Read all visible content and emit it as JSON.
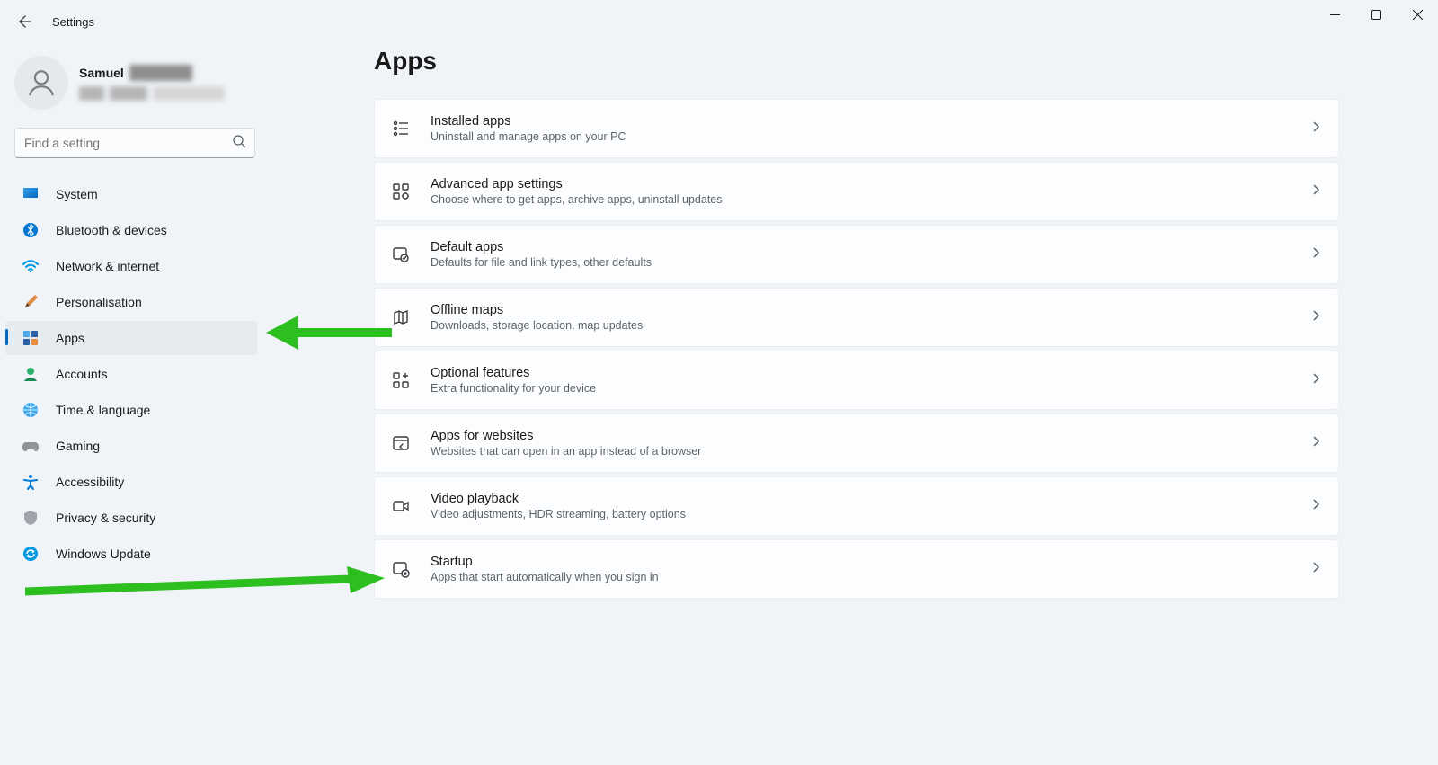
{
  "window": {
    "title": "Settings"
  },
  "profile": {
    "first_name": "Samuel"
  },
  "search": {
    "placeholder": "Find a setting"
  },
  "nav": {
    "items": [
      {
        "label": "System"
      },
      {
        "label": "Bluetooth & devices"
      },
      {
        "label": "Network & internet"
      },
      {
        "label": "Personalisation"
      },
      {
        "label": "Apps"
      },
      {
        "label": "Accounts"
      },
      {
        "label": "Time & language"
      },
      {
        "label": "Gaming"
      },
      {
        "label": "Accessibility"
      },
      {
        "label": "Privacy & security"
      },
      {
        "label": "Windows Update"
      }
    ]
  },
  "page": {
    "title": "Apps"
  },
  "cards": [
    {
      "title": "Installed apps",
      "subtitle": "Uninstall and manage apps on your PC"
    },
    {
      "title": "Advanced app settings",
      "subtitle": "Choose where to get apps, archive apps, uninstall updates"
    },
    {
      "title": "Default apps",
      "subtitle": "Defaults for file and link types, other defaults"
    },
    {
      "title": "Offline maps",
      "subtitle": "Downloads, storage location, map updates"
    },
    {
      "title": "Optional features",
      "subtitle": "Extra functionality for your device"
    },
    {
      "title": "Apps for websites",
      "subtitle": "Websites that can open in an app instead of a browser"
    },
    {
      "title": "Video playback",
      "subtitle": "Video adjustments, HDR streaming, battery options"
    },
    {
      "title": "Startup",
      "subtitle": "Apps that start automatically when you sign in"
    }
  ]
}
